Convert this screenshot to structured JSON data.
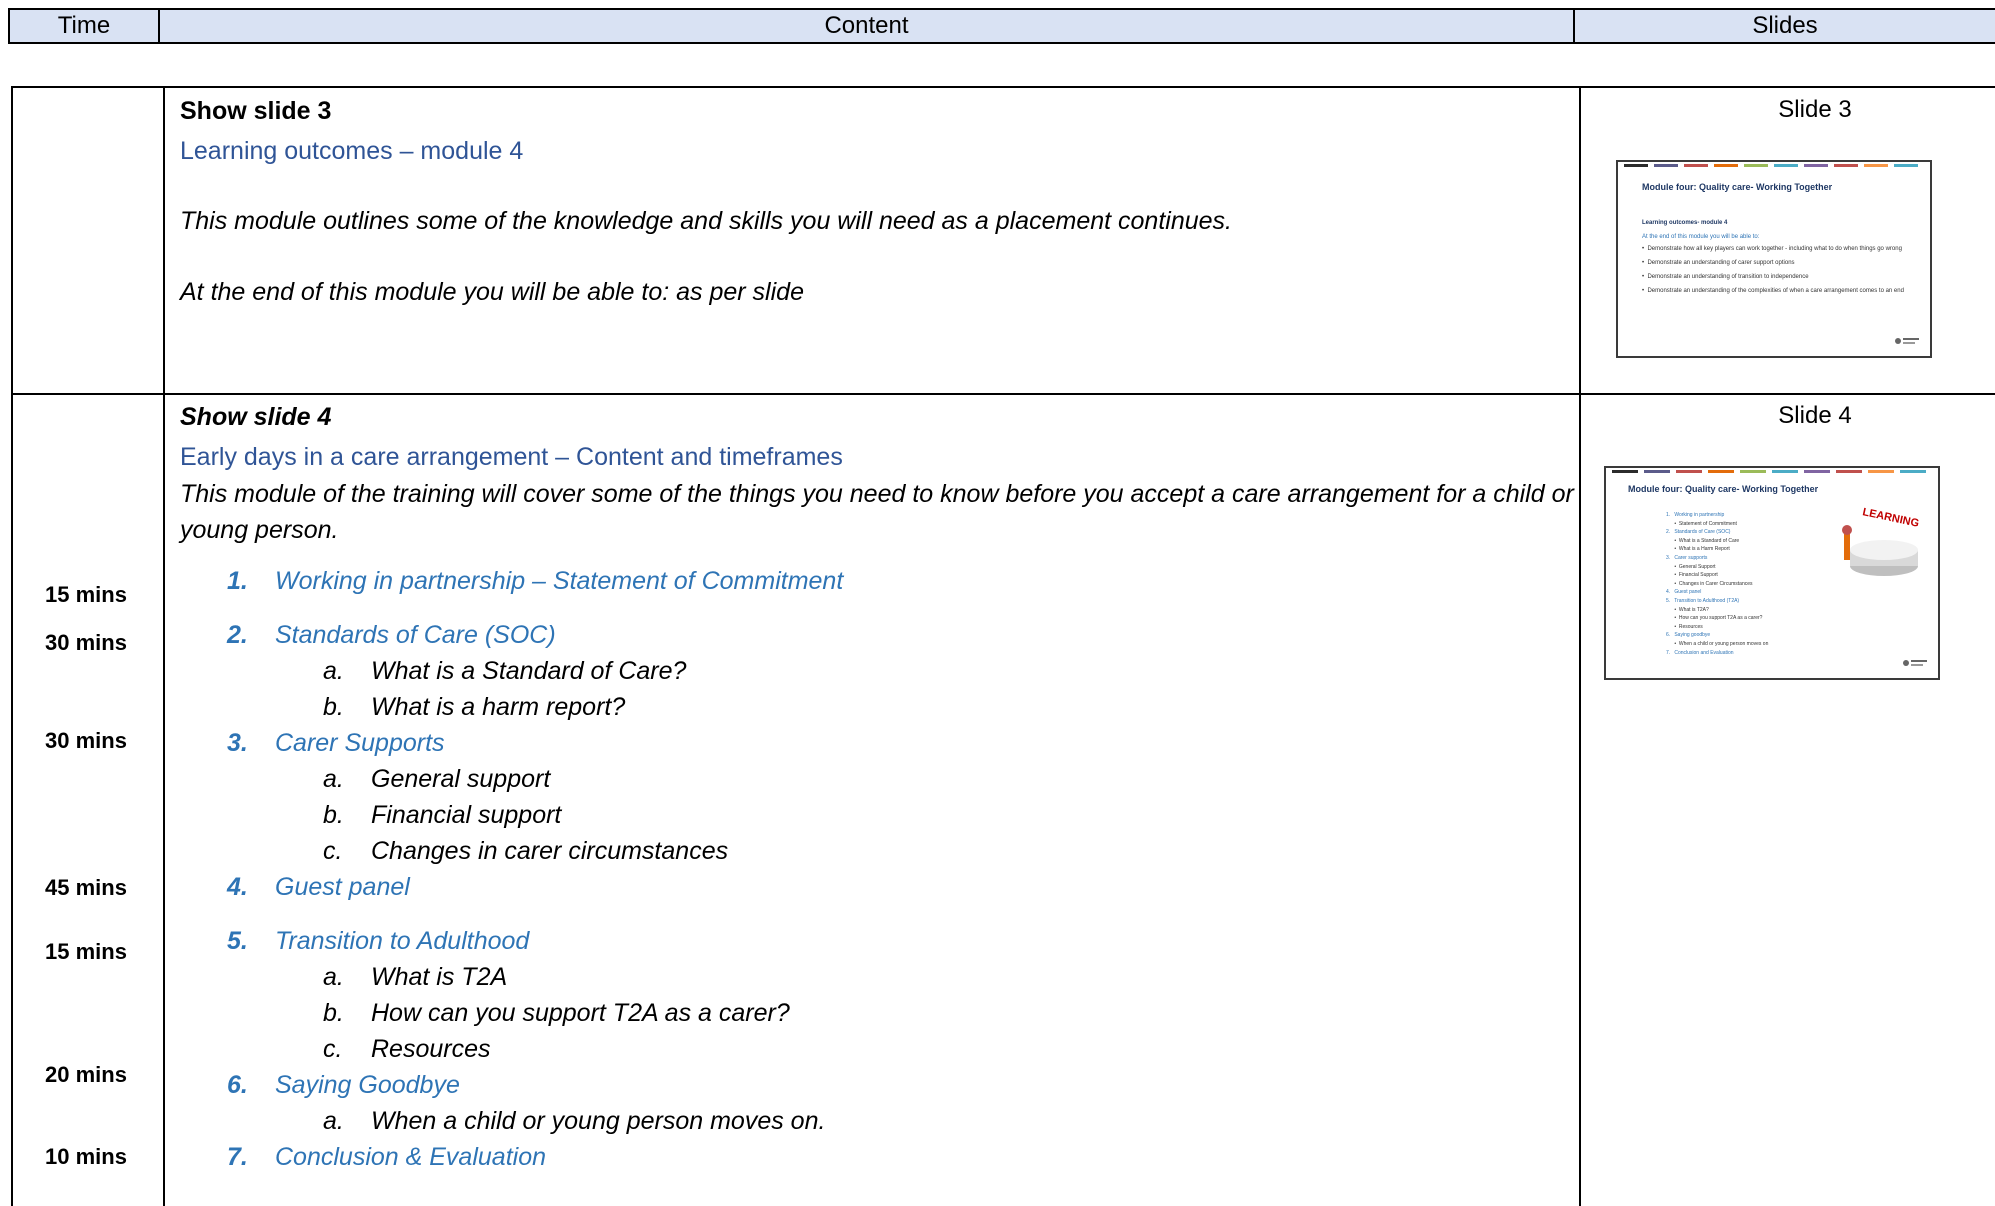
{
  "header": {
    "time": "Time",
    "content": "Content",
    "slides": "Slides"
  },
  "row1": {
    "show": "Show slide 3",
    "heading": "Learning outcomes – module 4",
    "para1": "This module outlines some of the knowledge and skills you will need as a placement continues.",
    "para2": "At the end of this module you will be able to:  as per slide",
    "slide_label": "Slide 3",
    "thumb": {
      "title": "Module four: Quality care- Working Together",
      "subtitle": "Learning outcomes- module 4",
      "intro": "At the end of this module you will be able to:",
      "bullets": [
        "Demonstrate how all key players can work together  - including what to do when things go wrong",
        "Demonstrate an understanding of carer support options",
        "Demonstrate an understanding of transition to independence",
        "Demonstrate an understanding of the complexities of when a care arrangement comes to an end"
      ]
    }
  },
  "row2": {
    "show": "Show slide 4",
    "heading": "Early days in a care arrangement – Content and timeframes",
    "para": "This module of the training will cover some of the things you need to know before you accept a care arrangement for a child or young person.",
    "slide_label": "Slide 4",
    "items": [
      {
        "num": "1.",
        "label": "Working in partnership – Statement of Commitment",
        "time": "15 mins"
      },
      {
        "num": "2.",
        "label": "Standards of Care (SOC)",
        "time": "30 mins"
      },
      {
        "num": "3.",
        "label": "Carer Supports",
        "time": "30 mins"
      },
      {
        "num": "4.",
        "label": "Guest panel",
        "time": "45 mins"
      },
      {
        "num": "5.",
        "label": "Transition to Adulthood",
        "time": "15 mins"
      },
      {
        "num": "6.",
        "label": "Saying Goodbye",
        "time": "20 mins"
      },
      {
        "num": "7.",
        "label": "Conclusion & Evaluation",
        "time": "10 mins"
      }
    ],
    "subs": {
      "soc_a": "What is a Standard of Care?",
      "soc_b": "What is a harm report?",
      "cs_a": "General support",
      "cs_b": "Financial support",
      "cs_c": "Changes in carer circumstances",
      "t2a_a": "What is T2A",
      "t2a_b": "How can you support T2A as a carer?",
      "t2a_c": "Resources",
      "bye_a": "When a child or young person moves on."
    },
    "sub_letters": {
      "a": "a.",
      "b": "b.",
      "c": "c."
    },
    "thumb": {
      "title": "Module four: Quality care- Working Together",
      "badge": "LEARNING",
      "lines": [
        "1.   Working in partnership",
        "      •  Statement of Commitment",
        "2.   Standards of Care (SOC)",
        "      •  What is a Standard of Care",
        "      •  What is a Harm Report",
        "3.   Carer supports",
        "      •  General Support",
        "      •  Financial Support",
        "      •  Changes in Carer Circumstances",
        "4.   Guest panel",
        "5.   Transition to Adulthood (T2A)",
        "      •  What is T2A?",
        "      •  How can you support T2A as a carer?",
        "      •  Resources",
        "6.   Saying goodbye",
        "      •  When a child or young person moves on",
        "7.   Conclusion and Evaluation"
      ]
    }
  },
  "colors": {
    "header_bg": "#d9e2f3",
    "heading": "#2f5496",
    "list_blue": "#2e74b5"
  }
}
